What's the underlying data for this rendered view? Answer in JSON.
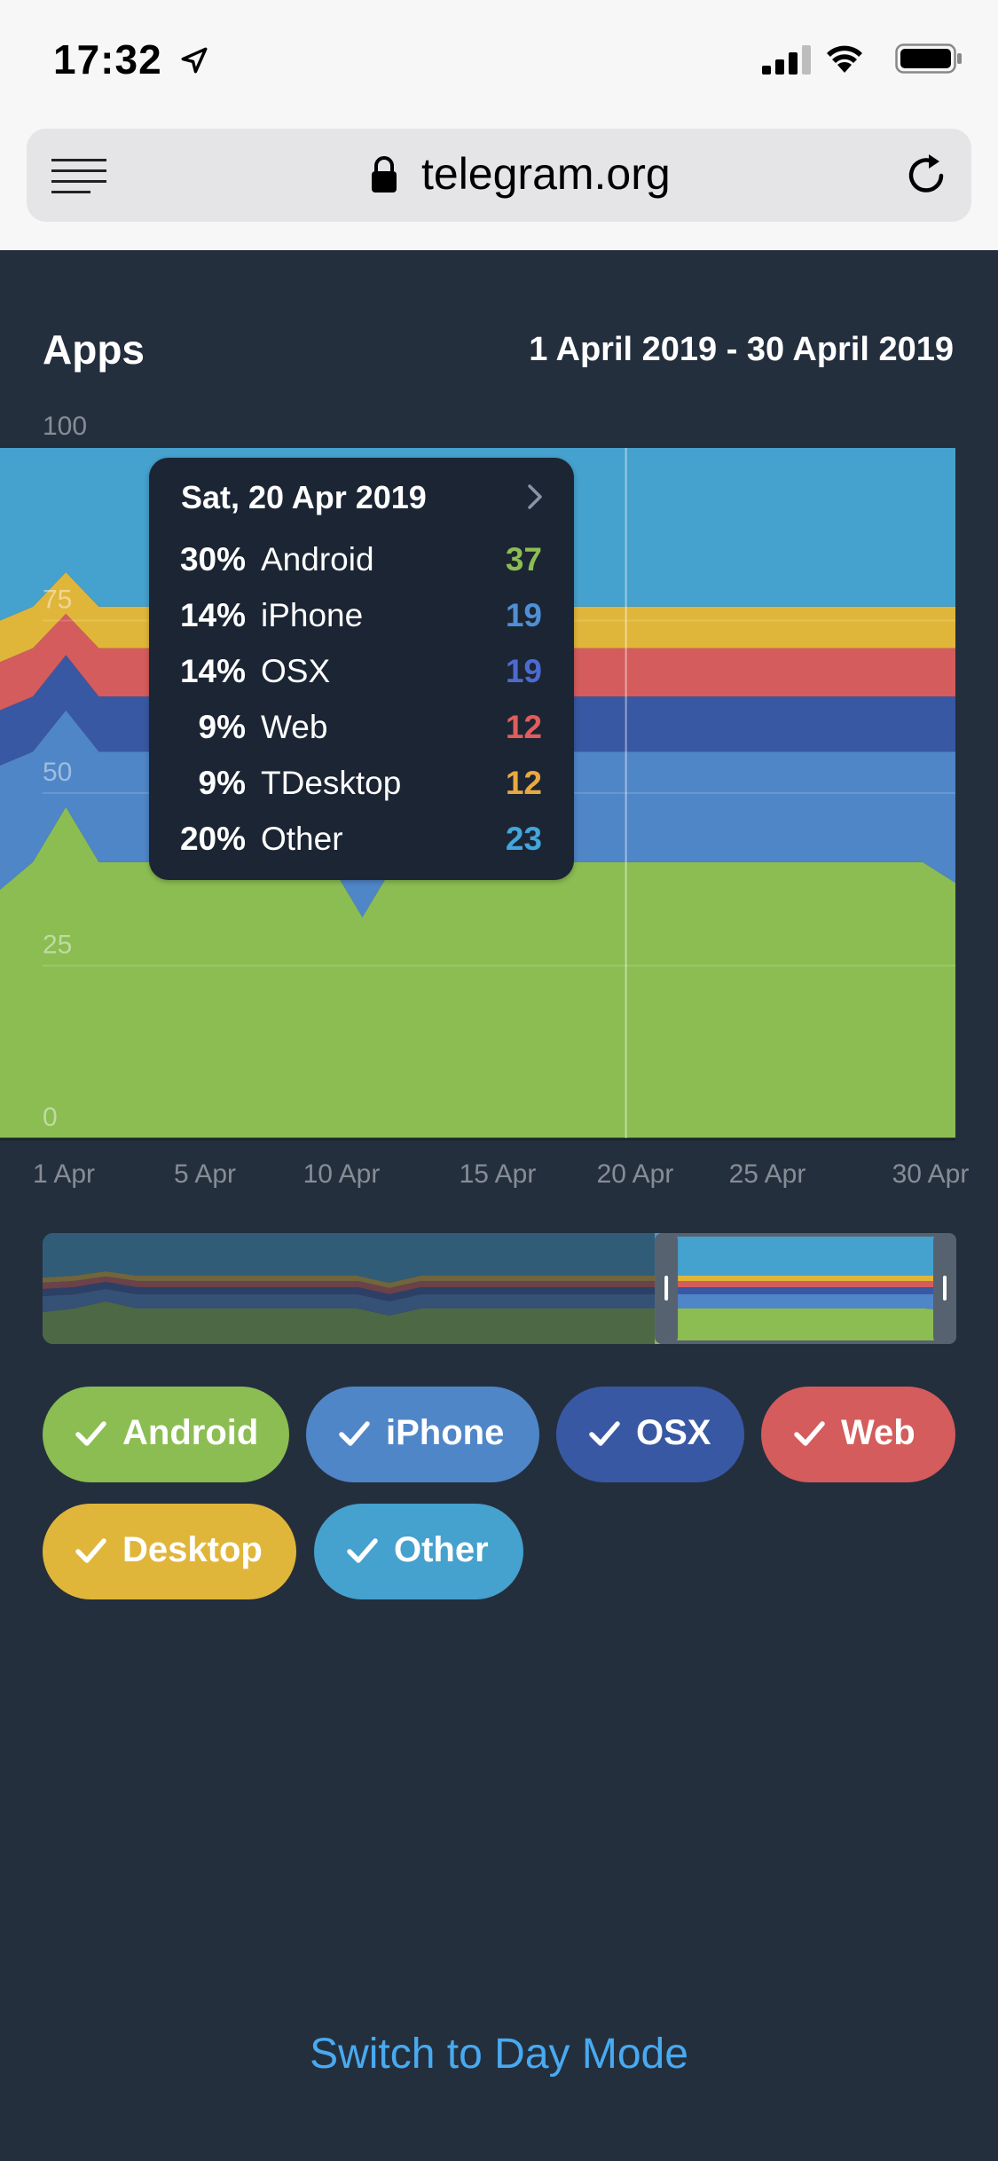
{
  "status": {
    "time": "17:32"
  },
  "browser": {
    "url": "telegram.org"
  },
  "chart_data": {
    "type": "area",
    "title": "Apps",
    "date_range": "1 April 2019 - 30 April 2019",
    "stacked_percent": true,
    "ylim": [
      0,
      100
    ],
    "yticks": [
      "0",
      "25",
      "50",
      "75",
      "100"
    ],
    "xticks": [
      "1 Apr",
      "5 Apr",
      "10 Apr",
      "15 Apr",
      "20 Apr",
      "25 Apr",
      "30 Apr"
    ],
    "x": [
      1,
      2,
      3,
      4,
      5,
      6,
      7,
      8,
      9,
      10,
      11,
      12,
      13,
      14,
      15,
      16,
      17,
      18,
      19,
      20,
      21,
      22,
      23,
      24,
      25,
      26,
      27,
      28,
      29,
      30
    ],
    "selected_x": 20,
    "grid": true,
    "series": [
      {
        "name": "Android",
        "color": "#8bbd52",
        "values": [
          36,
          40,
          48,
          40,
          40,
          40,
          40,
          40,
          40,
          40,
          40,
          32,
          40,
          40,
          40,
          40,
          40,
          40,
          40,
          40,
          40,
          40,
          40,
          40,
          40,
          40,
          40,
          40,
          40,
          37
        ]
      },
      {
        "name": "iPhone",
        "color": "#4f86c7",
        "values": [
          18,
          16,
          14,
          16,
          16,
          16,
          16,
          16,
          16,
          16,
          16,
          16,
          16,
          16,
          16,
          16,
          16,
          16,
          16,
          16,
          16,
          16,
          16,
          16,
          16,
          16,
          16,
          16,
          16,
          19
        ]
      },
      {
        "name": "OSX",
        "color": "#3958a3",
        "values": [
          8,
          8,
          8,
          8,
          8,
          8,
          8,
          8,
          8,
          8,
          8,
          8,
          8,
          8,
          8,
          8,
          8,
          8,
          8,
          8,
          8,
          8,
          8,
          8,
          8,
          8,
          8,
          8,
          8,
          8
        ]
      },
      {
        "name": "Web",
        "color": "#d45c5c",
        "values": [
          7,
          7,
          6,
          7,
          7,
          7,
          7,
          7,
          7,
          7,
          7,
          7,
          7,
          7,
          7,
          7,
          7,
          7,
          7,
          7,
          7,
          7,
          7,
          7,
          7,
          7,
          7,
          7,
          7,
          7
        ]
      },
      {
        "name": "TDesktop",
        "color": "#e0b63a",
        "values": [
          6,
          6,
          6,
          6,
          6,
          6,
          6,
          6,
          6,
          6,
          6,
          6,
          6,
          6,
          6,
          6,
          6,
          6,
          6,
          6,
          6,
          6,
          6,
          6,
          6,
          6,
          6,
          6,
          6,
          6
        ]
      },
      {
        "name": "Other",
        "color": "#45a1cd",
        "values": [
          25,
          23,
          18,
          23,
          23,
          23,
          23,
          23,
          23,
          23,
          23,
          31,
          23,
          23,
          23,
          23,
          23,
          23,
          23,
          23,
          23,
          23,
          23,
          23,
          23,
          23,
          23,
          23,
          23,
          23
        ]
      }
    ],
    "tooltip": {
      "title": "Sat, 20 Apr 2019",
      "rows": [
        {
          "pct": "30%",
          "name": "Android",
          "value": "37",
          "color": "#8bbd52"
        },
        {
          "pct": "14%",
          "name": "iPhone",
          "value": "19",
          "color": "#4f8fd6"
        },
        {
          "pct": "14%",
          "name": "OSX",
          "value": "19",
          "color": "#4d6ad0"
        },
        {
          "pct": "9%",
          "name": "Web",
          "value": "12",
          "color": "#e05d5d"
        },
        {
          "pct": "9%",
          "name": "TDesktop",
          "value": "12",
          "color": "#e9a940"
        },
        {
          "pct": "20%",
          "name": "Other",
          "value": "23",
          "color": "#43a6dc"
        }
      ]
    },
    "navigator_window": [
      0.67,
      1.0
    ]
  },
  "chips": [
    {
      "label": "Android",
      "color": "#8bbd52"
    },
    {
      "label": "iPhone",
      "color": "#4f86c7"
    },
    {
      "label": "OSX",
      "color": "#3958a3"
    },
    {
      "label": "Web",
      "color": "#d45c5c"
    },
    {
      "label": "Desktop",
      "color": "#e0b63a"
    },
    {
      "label": "Other",
      "color": "#45a1cd"
    }
  ],
  "footer": {
    "switch_label": "Switch to Day Mode"
  }
}
